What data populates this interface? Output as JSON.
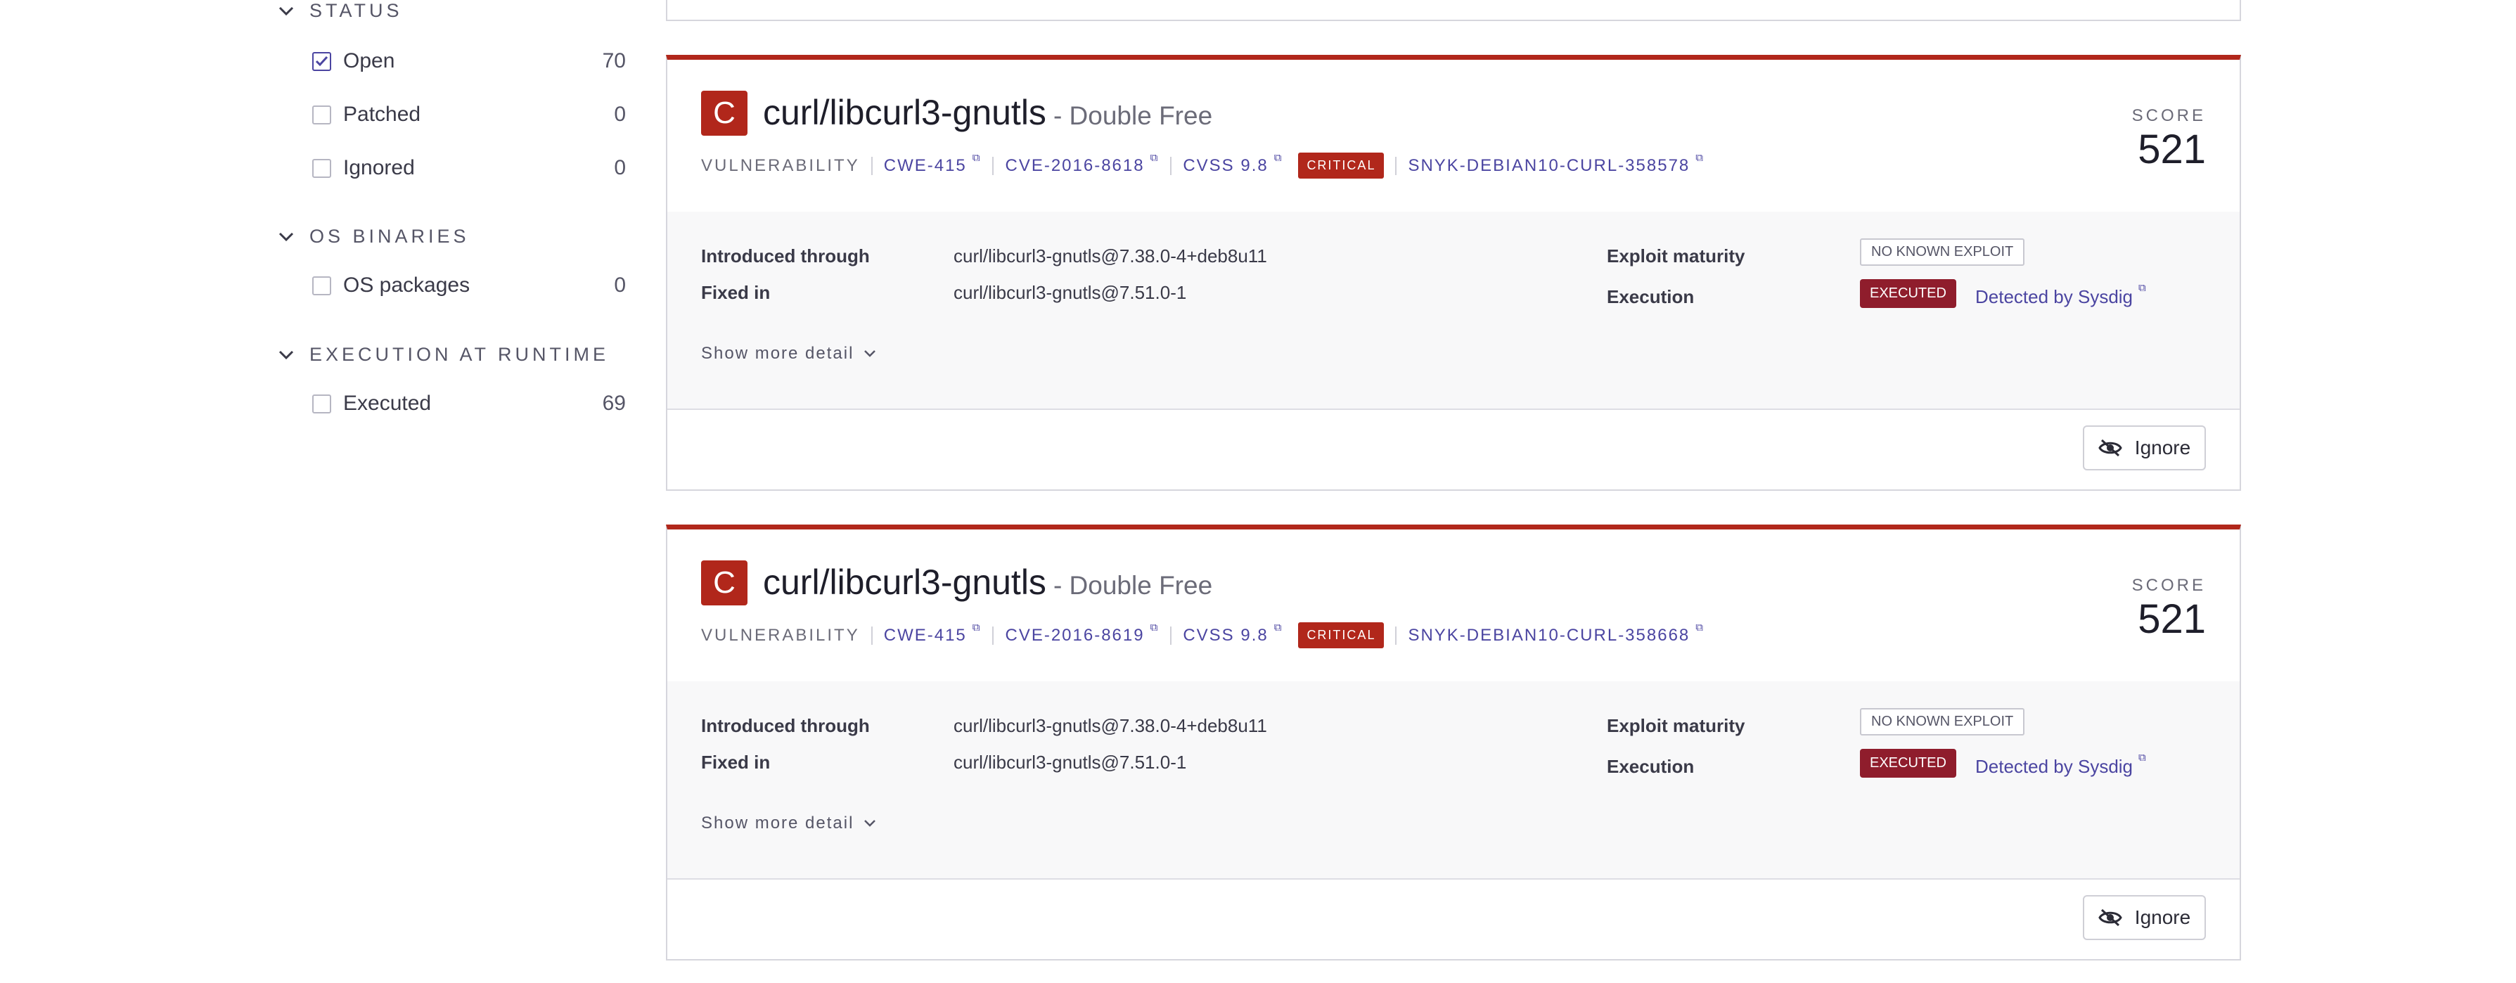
{
  "sidebar": {
    "status": {
      "title": "STATUS",
      "items": [
        {
          "label": "Open",
          "count": "70",
          "checked": true
        },
        {
          "label": "Patched",
          "count": "0",
          "checked": false
        },
        {
          "label": "Ignored",
          "count": "0",
          "checked": false
        }
      ]
    },
    "os_binaries": {
      "title": "OS BINARIES",
      "items": [
        {
          "label": "OS packages",
          "count": "0",
          "checked": false
        }
      ]
    },
    "execution_at_runtime": {
      "title": "EXECUTION AT RUNTIME",
      "items": [
        {
          "label": "Executed",
          "count": "69",
          "checked": false
        }
      ]
    }
  },
  "cards": [
    {
      "severity_letter": "C",
      "package": "curl/libcurl3-gnutls",
      "vuln_type": "- Double Free",
      "category": "VULNERABILITY",
      "cwe": "CWE-415",
      "cve": "CVE-2016-8618",
      "cvss": "CVSS 9.8",
      "severity": "CRITICAL",
      "snyk_id": "SNYK-DEBIAN10-CURL-358578",
      "score_label": "SCORE",
      "score": "521",
      "introduced_label": "Introduced through",
      "introduced_value": "curl/libcurl3-gnutls@7.38.0-4+deb8u11",
      "fixed_label": "Fixed in",
      "fixed_value": "curl/libcurl3-gnutls@7.51.0-1",
      "exploit_label": "Exploit maturity",
      "exploit_value": "NO KNOWN EXPLOIT",
      "execution_label": "Execution",
      "execution_value": "EXECUTED",
      "detected_by": "Detected by Sysdig",
      "show_more": "Show more detail",
      "ignore_label": "Ignore"
    },
    {
      "severity_letter": "C",
      "package": "curl/libcurl3-gnutls",
      "vuln_type": "- Double Free",
      "category": "VULNERABILITY",
      "cwe": "CWE-415",
      "cve": "CVE-2016-8619",
      "cvss": "CVSS 9.8",
      "severity": "CRITICAL",
      "snyk_id": "SNYK-DEBIAN10-CURL-358668",
      "score_label": "SCORE",
      "score": "521",
      "introduced_label": "Introduced through",
      "introduced_value": "curl/libcurl3-gnutls@7.38.0-4+deb8u11",
      "fixed_label": "Fixed in",
      "fixed_value": "curl/libcurl3-gnutls@7.51.0-1",
      "exploit_label": "Exploit maturity",
      "exploit_value": "NO KNOWN EXPLOIT",
      "execution_label": "Execution",
      "execution_value": "EXECUTED",
      "detected_by": "Detected by Sysdig",
      "show_more": "Show more detail",
      "ignore_label": "Ignore"
    }
  ],
  "icons": {
    "chevron": "chevron-down-icon",
    "external": "external-link-icon",
    "ignore": "eye-off-icon",
    "check": "check-icon"
  },
  "colors": {
    "critical": "#b1271b",
    "executed": "#8f1d2c",
    "link": "#4b45a1"
  }
}
